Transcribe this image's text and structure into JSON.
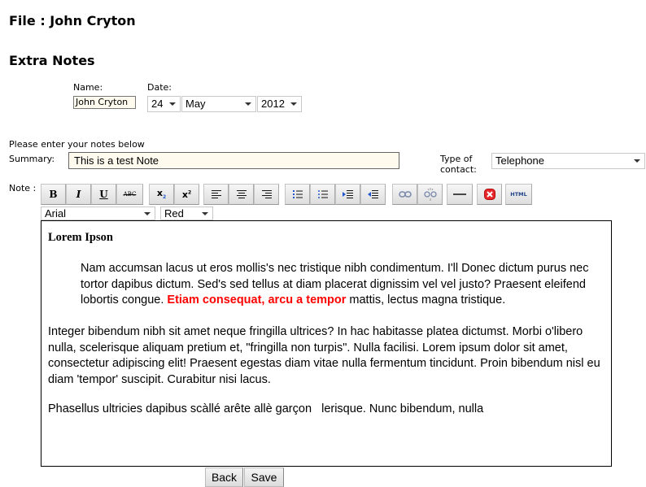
{
  "header": {
    "file_title": "File : John Cryton",
    "section_title": "Extra Notes"
  },
  "form": {
    "name_label": "Name:",
    "name_value": "John Cryton",
    "date_label": "Date:",
    "day_value": "24",
    "month_value": "May",
    "year_value": "2012",
    "instructions": "Please enter your notes below",
    "summary_label": "Summary:",
    "summary_value": "This is a test Note",
    "contact_type_label_line1": "Type of",
    "contact_type_label_line2": "contact:",
    "contact_type_value": "Telephone",
    "note_label": "Note :"
  },
  "toolbar": {
    "buttons": [
      {
        "name": "bold",
        "glyph": "B"
      },
      {
        "name": "italic",
        "glyph": "I"
      },
      {
        "name": "underline",
        "glyph": "U"
      },
      {
        "name": "strikethrough",
        "glyph": "ABC"
      },
      {
        "name": "subscript",
        "glyph": "x₂"
      },
      {
        "name": "superscript",
        "glyph": "x²"
      },
      {
        "name": "align-left"
      },
      {
        "name": "align-center"
      },
      {
        "name": "align-right"
      },
      {
        "name": "ordered-list"
      },
      {
        "name": "unordered-list"
      },
      {
        "name": "indent"
      },
      {
        "name": "outdent"
      },
      {
        "name": "link"
      },
      {
        "name": "unlink"
      },
      {
        "name": "horizontal-rule"
      },
      {
        "name": "remove-format"
      },
      {
        "name": "html-source",
        "glyph": "HTML"
      }
    ],
    "font_value": "Arial",
    "color_value": "Red"
  },
  "editor": {
    "heading": "Lorem Ipson",
    "para1_before": "Nam accumsan lacus ut eros mollis's nec tristique nibh condimentum. I'll Donec dictum purus nec tortor dapibus dictum. Sed's sed tellus at diam placerat dignissim vel vel justo? Praesent eleifend lobortis congue. ",
    "para1_highlight": "Etiam consequat, arcu a tempor",
    "para1_after": " mattis, lectus magna tristique.",
    "para2": "Integer bibendum nibh sit amet neque fringilla ultrices? In hac habitasse platea dictumst. Morbi o'libero nulla, scelerisque aliquam pretium et, \"fringilla non turpis\". Nulla facilisi. Lorem ipsum dolor sit amet, consectetur adipiscing elit! Praesent egestas diam vitae nulla fermentum tincidunt. Proin bibendum nisl eu diam 'tempor' suscipit. Curabitur nisi lacus.",
    "para3": "Phasellus ultricies dapibus scàllé arête allè garçon   lerisque. Nunc bibendum, nulla",
    "highlight_color": "#ff0000"
  },
  "actions": {
    "back_label": "Back",
    "save_label": "Save"
  }
}
